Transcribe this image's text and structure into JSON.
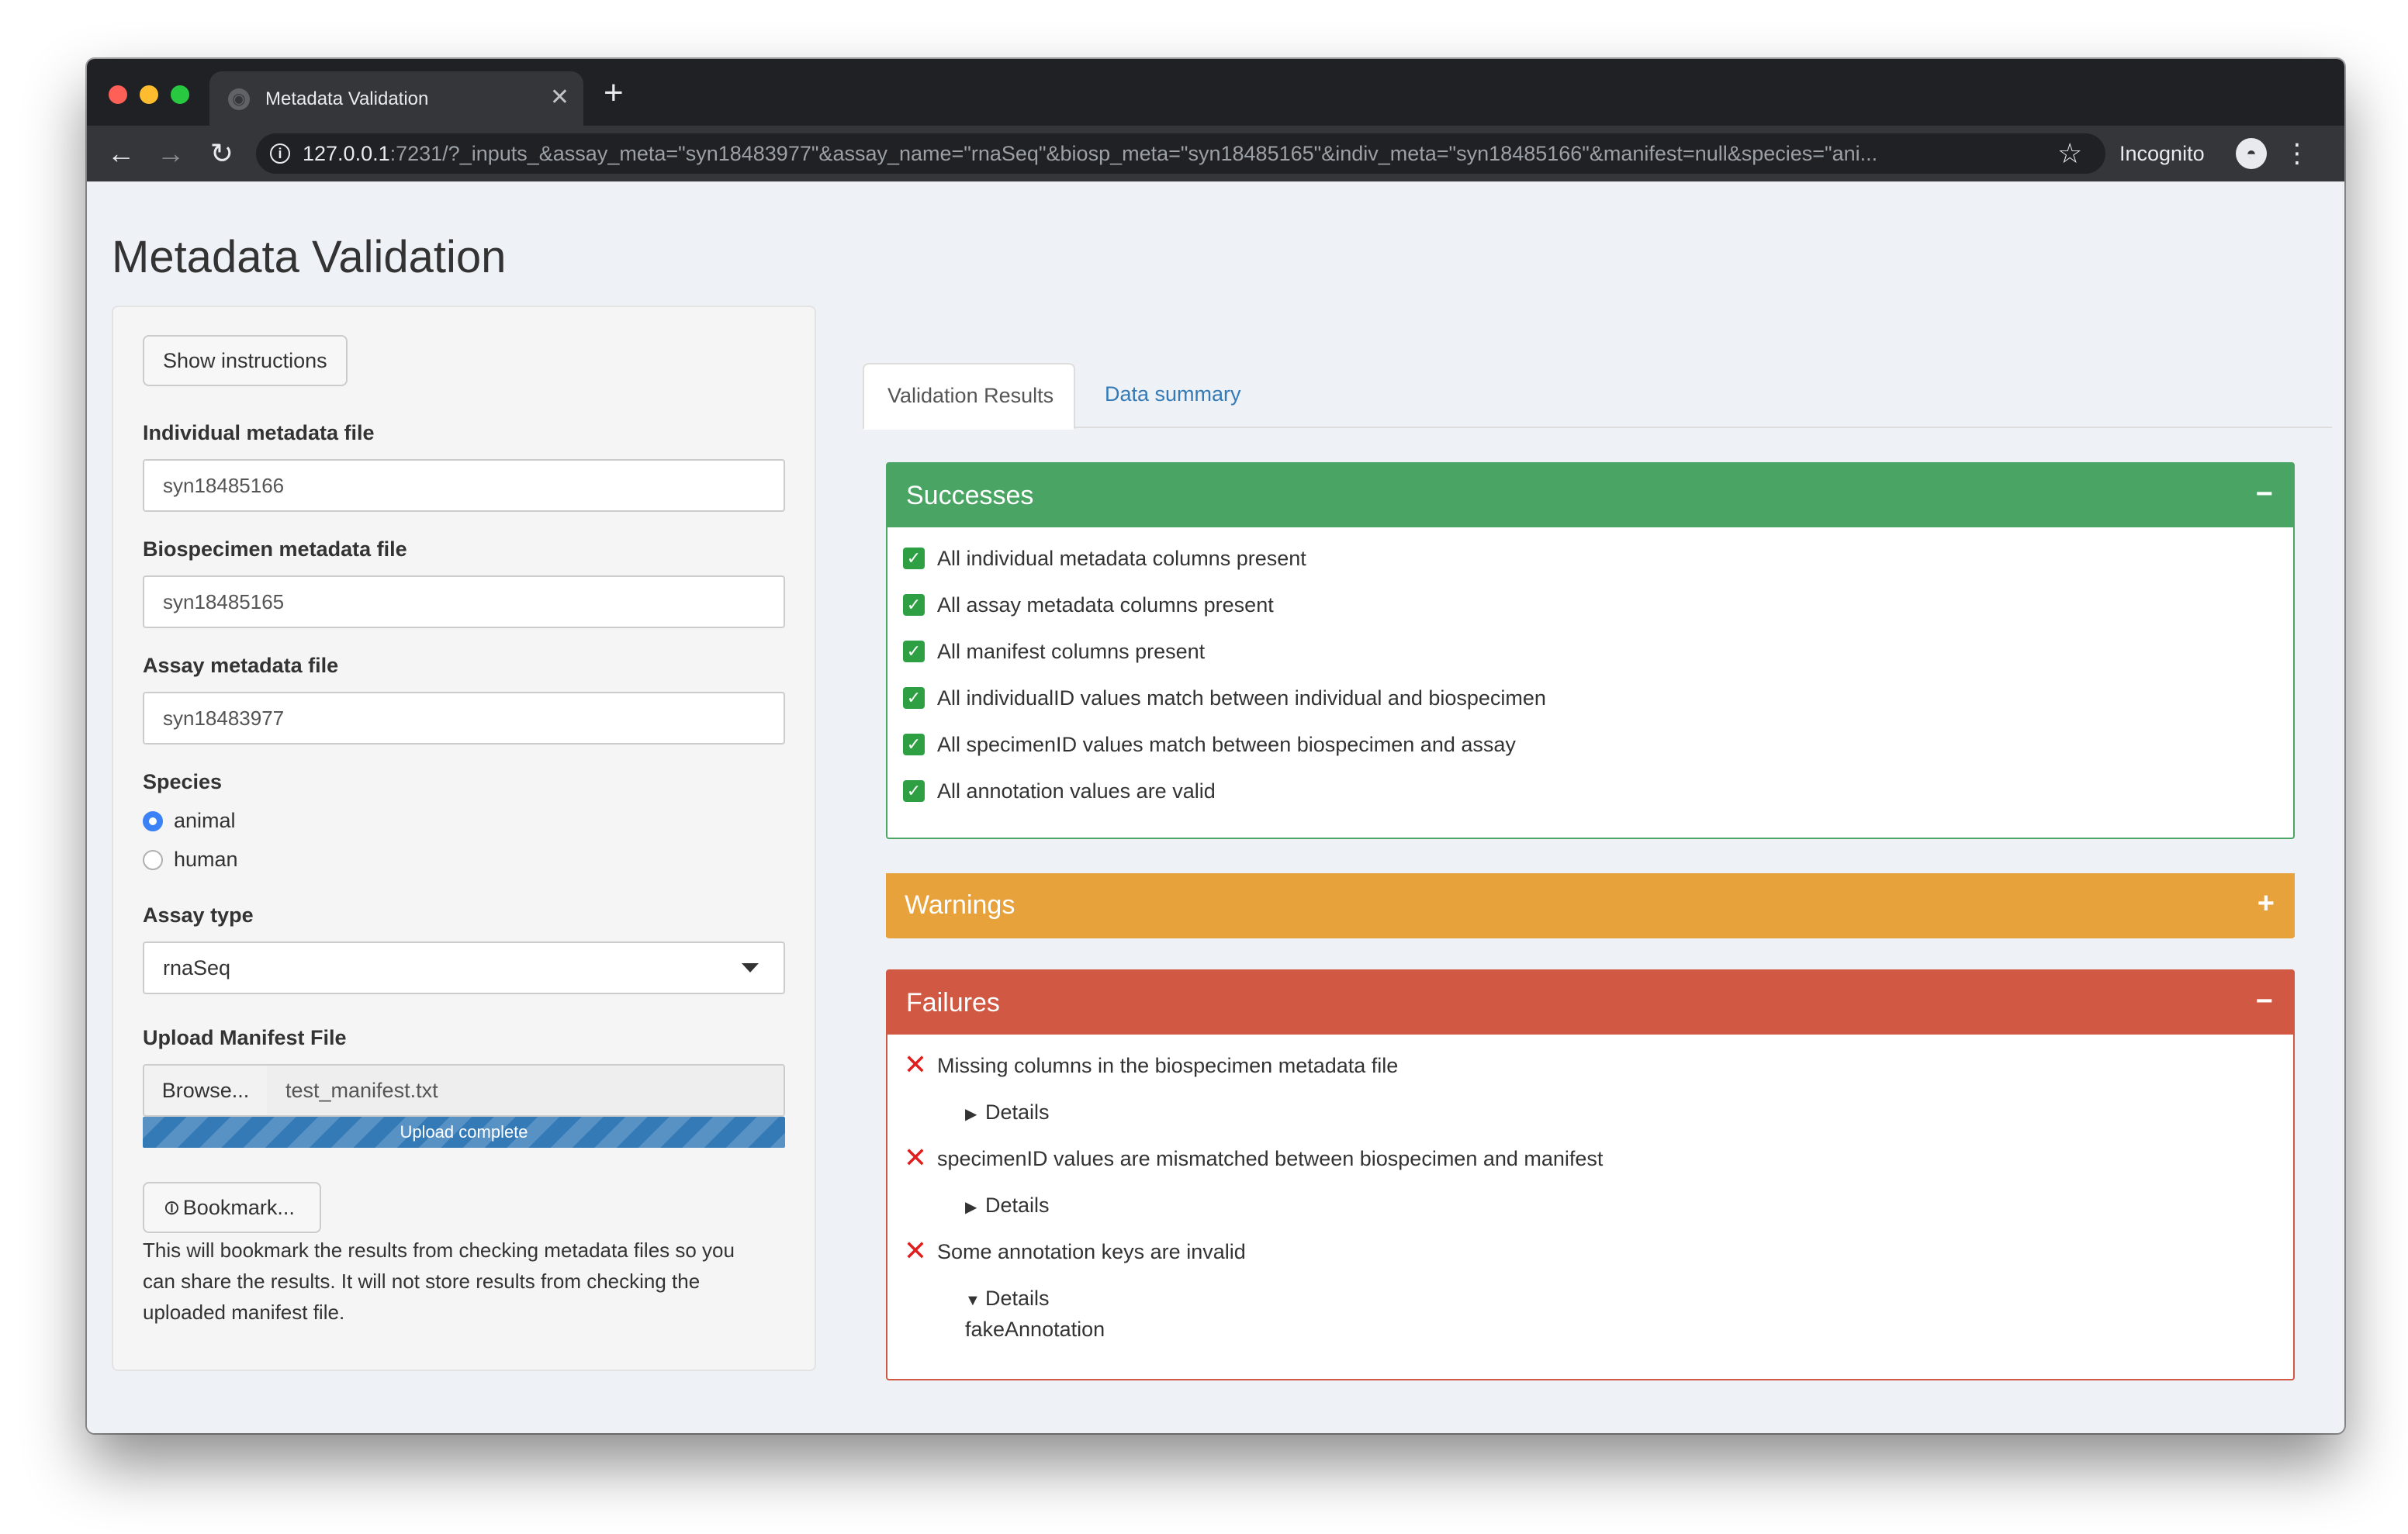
{
  "browser": {
    "tab_title": "Metadata Validation",
    "new_tab": "+",
    "close_tab": "✕",
    "url_host": "127.0.0.1",
    "url_rest": ":7231/?_inputs_&assay_meta=\"syn18483977\"&assay_name=\"rnaSeq\"&biosp_meta=\"syn18485165\"&indiv_meta=\"syn18485166\"&manifest=null&species=\"ani...",
    "incognito_label": "Incognito",
    "icons": [
      "back-arrow-icon",
      "forward-arrow-icon",
      "reload-icon",
      "info-icon",
      "star-icon",
      "incognito-icon",
      "menu-icon",
      "globe-icon",
      "close-icon"
    ]
  },
  "page": {
    "title": "Metadata Validation"
  },
  "sidebar": {
    "instructions_button": "Show instructions",
    "individual_label": "Individual metadata file",
    "individual_value": "syn18485166",
    "biospecimen_label": "Biospecimen metadata file",
    "biospecimen_value": "syn18485165",
    "assay_label": "Assay metadata file",
    "assay_value": "syn18483977",
    "species_label": "Species",
    "species_options": [
      {
        "label": "animal",
        "checked": true
      },
      {
        "label": "human",
        "checked": false
      }
    ],
    "assay_type_label": "Assay type",
    "assay_type_value": "rnaSeq",
    "upload_label": "Upload Manifest File",
    "browse_button": "Browse...",
    "file_name": "test_manifest.txt",
    "upload_status": "Upload complete",
    "upload_progress_percent": 100,
    "bookmark_button": "Bookmark...",
    "bookmark_help": "This will bookmark the results from checking metadata files so you can share the results. It will not store results from checking the uploaded manifest file."
  },
  "tabs": [
    {
      "label": "Validation Results",
      "active": true
    },
    {
      "label": "Data summary",
      "active": false
    }
  ],
  "successes": {
    "title": "Successes",
    "toggle": "−",
    "color": "#4aa564",
    "items": [
      "All individual metadata columns present",
      "All assay metadata columns present",
      "All manifest columns present",
      "All individualID values match between individual and biospecimen",
      "All specimenID values match between biospecimen and assay",
      "All annotation values are valid"
    ]
  },
  "warnings": {
    "title": "Warnings",
    "toggle": "+",
    "color": "#e8a23c"
  },
  "failures": {
    "title": "Failures",
    "toggle": "−",
    "color": "#d15843",
    "items": [
      {
        "text": "Missing columns in the biospecimen metadata file",
        "details_label": "Details",
        "expanded": false
      },
      {
        "text": "specimenID values are mismatched between biospecimen and manifest",
        "details_label": "Details",
        "expanded": false
      },
      {
        "text": "Some annotation keys are invalid",
        "details_label": "Details",
        "expanded": true,
        "details_value": "fakeAnnotation"
      }
    ]
  }
}
